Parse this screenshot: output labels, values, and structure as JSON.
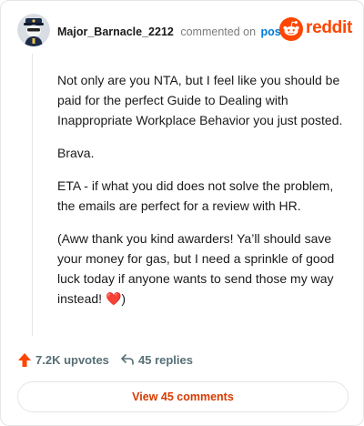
{
  "header": {
    "username": "Major_Barnacle_2212",
    "commented_text": "commented on",
    "post_link": "post",
    "logo_text": "reddit"
  },
  "comment": {
    "paragraphs": [
      "Not only are you NTA, but I feel like you should be paid for the perfect Guide to Dealing with Inappropriate Workplace Behavior you just posted.",
      "Brava.",
      "ETA - if what you did does not solve the problem, the emails are perfect for a review with HR.",
      "(Aww thank you kind awarders! Ya’ll should save your money for gas, but I need a sprinkle of good luck today if anyone wants to send those my way instead! "
    ],
    "last_paragraph_end": ")",
    "heart_emoji": "❤️"
  },
  "actions": {
    "upvotes": "7.2K upvotes",
    "replies": "45 replies"
  },
  "view_comments_label": "View 45 comments",
  "colors": {
    "brand": "#ff4500",
    "link": "#0079d3",
    "view_button_text": "#d93a00"
  },
  "icons": {
    "avatar": "snoo-avatar",
    "logo": "reddit-snoo-icon",
    "upvote": "upvote-arrow-icon",
    "reply": "reply-arrow-icon"
  }
}
